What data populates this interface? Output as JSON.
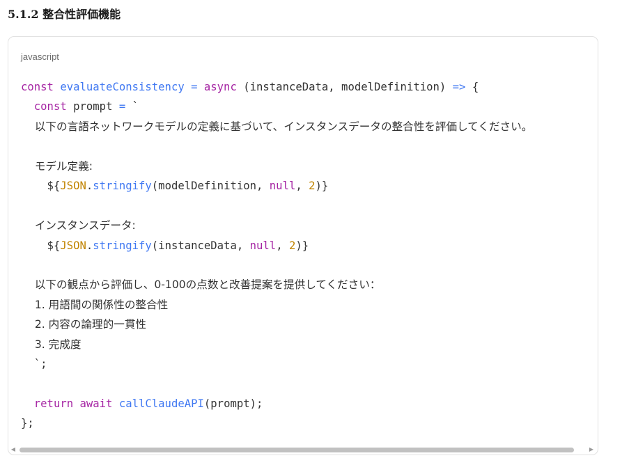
{
  "section": {
    "title": "5.1.2 整合性評価機能"
  },
  "code_block": {
    "language": "javascript",
    "lines": [
      [
        {
          "t": "kw",
          "v": "const "
        },
        {
          "t": "fn",
          "v": "evaluateConsistency "
        },
        {
          "t": "op",
          "v": "= "
        },
        {
          "t": "kw",
          "v": "async "
        },
        {
          "t": "plain",
          "v": "(instanceData, modelDefinition) "
        },
        {
          "t": "op",
          "v": "=> "
        },
        {
          "t": "plain",
          "v": "{"
        }
      ],
      [
        {
          "t": "plain",
          "v": "  "
        },
        {
          "t": "kw",
          "v": "const "
        },
        {
          "t": "plain",
          "v": "prompt "
        },
        {
          "t": "op",
          "v": "= "
        },
        {
          "t": "str",
          "v": "`"
        }
      ],
      [
        {
          "t": "str",
          "v": "    以下の言語ネットワークモデルの定義に基づいて、インスタンスデータの整合性を評価してください。"
        }
      ],
      [
        {
          "t": "str",
          "v": ""
        }
      ],
      [
        {
          "t": "str",
          "v": "    モデル定義:"
        }
      ],
      [
        {
          "t": "str",
          "v": "    ${"
        },
        {
          "t": "cls",
          "v": "JSON"
        },
        {
          "t": "plain",
          "v": "."
        },
        {
          "t": "fn",
          "v": "stringify"
        },
        {
          "t": "plain",
          "v": "(modelDefinition, "
        },
        {
          "t": "kw",
          "v": "null"
        },
        {
          "t": "plain",
          "v": ", "
        },
        {
          "t": "num",
          "v": "2"
        },
        {
          "t": "plain",
          "v": ")}"
        }
      ],
      [
        {
          "t": "str",
          "v": ""
        }
      ],
      [
        {
          "t": "str",
          "v": "    インスタンスデータ:"
        }
      ],
      [
        {
          "t": "str",
          "v": "    ${"
        },
        {
          "t": "cls",
          "v": "JSON"
        },
        {
          "t": "plain",
          "v": "."
        },
        {
          "t": "fn",
          "v": "stringify"
        },
        {
          "t": "plain",
          "v": "(instanceData, "
        },
        {
          "t": "kw",
          "v": "null"
        },
        {
          "t": "plain",
          "v": ", "
        },
        {
          "t": "num",
          "v": "2"
        },
        {
          "t": "plain",
          "v": ")}"
        }
      ],
      [
        {
          "t": "str",
          "v": ""
        }
      ],
      [
        {
          "t": "str",
          "v": "    以下の観点から評価し、0-100の点数と改善提案を提供してください："
        }
      ],
      [
        {
          "t": "str",
          "v": "    1. 用語間の関係性の整合性"
        }
      ],
      [
        {
          "t": "str",
          "v": "    2. 内容の論理的一貫性"
        }
      ],
      [
        {
          "t": "str",
          "v": "    3. 完成度"
        }
      ],
      [
        {
          "t": "str",
          "v": "  `;"
        }
      ],
      [
        {
          "t": "plain",
          "v": ""
        }
      ],
      [
        {
          "t": "plain",
          "v": "  "
        },
        {
          "t": "kw",
          "v": "return "
        },
        {
          "t": "kw",
          "v": "await "
        },
        {
          "t": "fn",
          "v": "callClaudeAPI"
        },
        {
          "t": "plain",
          "v": "(prompt);"
        }
      ],
      [
        {
          "t": "plain",
          "v": "};"
        }
      ]
    ]
  },
  "scrollbar": {
    "left_arrow": "◀",
    "right_arrow": "▶"
  },
  "colors": {
    "keyword": "#a626a4",
    "function": "#4078f2",
    "operator": "#4078f2",
    "class": "#c18401",
    "number": "#c18401",
    "text": "#333333",
    "card_border": "#e2e2e2",
    "scroll_thumb": "#c1c1c1"
  }
}
